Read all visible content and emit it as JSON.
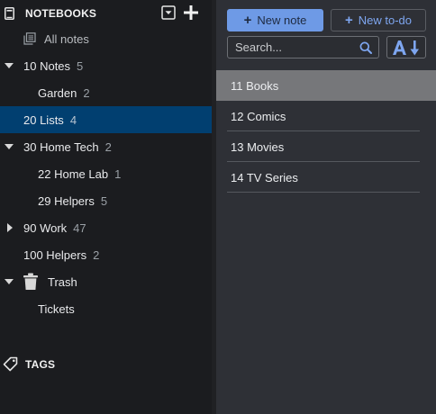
{
  "sidebar": {
    "notebooks_header": "NOTEBOOKS",
    "tags_header": "TAGS",
    "all_notes": "All notes",
    "items": [
      {
        "title": "10 Notes",
        "count": "5"
      },
      {
        "title": "Garden",
        "count": "2"
      },
      {
        "title": "20 Lists",
        "count": "4"
      },
      {
        "title": "30 Home Tech",
        "count": "2"
      },
      {
        "title": "22 Home Lab",
        "count": "1"
      },
      {
        "title": "29 Helpers",
        "count": "5"
      },
      {
        "title": "90 Work",
        "count": "47"
      },
      {
        "title": "100 Helpers",
        "count": "2"
      },
      {
        "title": "Trash",
        "count": ""
      },
      {
        "title": "Tickets",
        "count": ""
      }
    ],
    "selected": "20 Lists"
  },
  "toolbar": {
    "new_note_label": "New note",
    "new_todo_label": "New to-do",
    "search_placeholder": "Search...",
    "sort_icon": "sort-alpha-icon"
  },
  "notes": {
    "items": [
      {
        "title": "11 Books"
      },
      {
        "title": "12 Comics"
      },
      {
        "title": "13 Movies"
      },
      {
        "title": "14 TV Series"
      }
    ],
    "selected": "11 Books"
  },
  "colors": {
    "sidebar_bg": "#1b1c1f",
    "list_bg": "#2e3036",
    "selected_notebook": "#013f70",
    "selected_note": "#76777a",
    "accent": "#6e9ae6"
  }
}
